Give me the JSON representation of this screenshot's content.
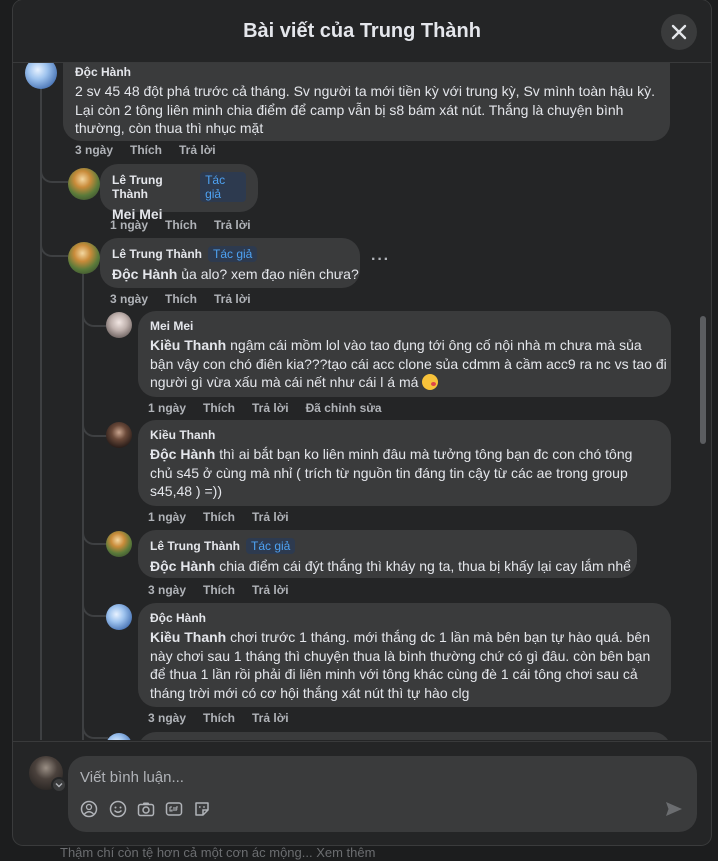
{
  "background": {
    "footer_text": "Thậm chí còn tệ hơn cả một cơn ác mộng... Xem thêm"
  },
  "modal": {
    "title": "Bài viết của Trung Thành",
    "close_icon": "close-icon"
  },
  "comments": [
    {
      "author": "Độc Hành",
      "lines": [
        "2 sv 45 48 đột phá trước cả tháng. Sv người ta mới tiền kỳ với trung kỳ, Sv mình toàn hậu kỳ.",
        "Lại còn 2 tông liên minh chia điểm để camp vẫn bị s8 bám xát nút. Thắng là chuyện bình",
        "thường, còn thua thì nhục mặt"
      ],
      "time": "3 ngày",
      "like": "Thích",
      "reply": "Trả lời"
    },
    {
      "author": "Lê Trung Thành",
      "badge": "Tác giả",
      "text": "Mei Mei",
      "time": "1 ngày",
      "like": "Thích",
      "reply": "Trả lời"
    },
    {
      "author": "Lê Trung Thành",
      "badge": "Tác giả",
      "mention": "Độc Hành",
      "text": " ủa alo? xem đạo niên chưa?",
      "more": "···",
      "time": "3 ngày",
      "like": "Thích",
      "reply": "Trả lời"
    },
    {
      "author": "Mei Mei",
      "mention": "Kiều Thanh",
      "line1": " ngậm cái mồm lol vào tao đụng tới ông cố nội nhà m chưa mà sủa",
      "line2": "bận vậy con chó điên kia???tạo cái acc clone sủa cdmm à cầm acc9 ra nc vs tao đi",
      "line3": "người gì vừa xấu mà cái nết như cái l á má ",
      "emoji": "kissing-face-emoji",
      "time": "1 ngày",
      "like": "Thích",
      "reply": "Trả lời",
      "edited": "Đã chỉnh sửa"
    },
    {
      "author": "Kiều Thanh",
      "mention": "Độc Hành",
      "line1": " thì ai bắt bạn ko liên minh đâu mà tưởng tông bạn đc con chó tông",
      "line2": "chủ s45 ở cùng mà nhỉ ( trích từ nguồn tin đáng tin cậy từ các ae trong group",
      "line3": "s45,48 ) =))",
      "time": "1 ngày",
      "like": "Thích",
      "reply": "Trả lời"
    },
    {
      "author": "Lê Trung Thành",
      "badge": "Tác giả",
      "mention": "Độc Hành",
      "text": " chia điểm cái đýt thắng thì kháy ng ta, thua bị khấy lại cay lắm nhể",
      "time": "3 ngày",
      "like": "Thích",
      "reply": "Trả lời"
    },
    {
      "author": "Độc Hành",
      "mention": "Kiều Thanh",
      "line1": " chơi trước 1 tháng. mới thắng dc 1 lần mà bên bạn tự hào quá. bên",
      "line2": "này chơi sau 1 tháng thì chuyện thua là bình thường chứ có gì đâu. còn bên bạn",
      "line3": "để thua 1 lần rồi phải đi liên minh với tông khác cùng đè 1 cái tông chơi sau cả",
      "line4": "tháng trời mới có cơ hội thắng xát nút thì tự hào clg",
      "time": "3 ngày",
      "like": "Thích",
      "reply": "Trả lời"
    }
  ],
  "composer": {
    "placeholder": "Viết bình luận...",
    "tools": [
      "avatar-sticker-icon",
      "emoji-icon",
      "camera-icon",
      "gif-icon",
      "sticker-icon"
    ],
    "send": "send-icon"
  }
}
